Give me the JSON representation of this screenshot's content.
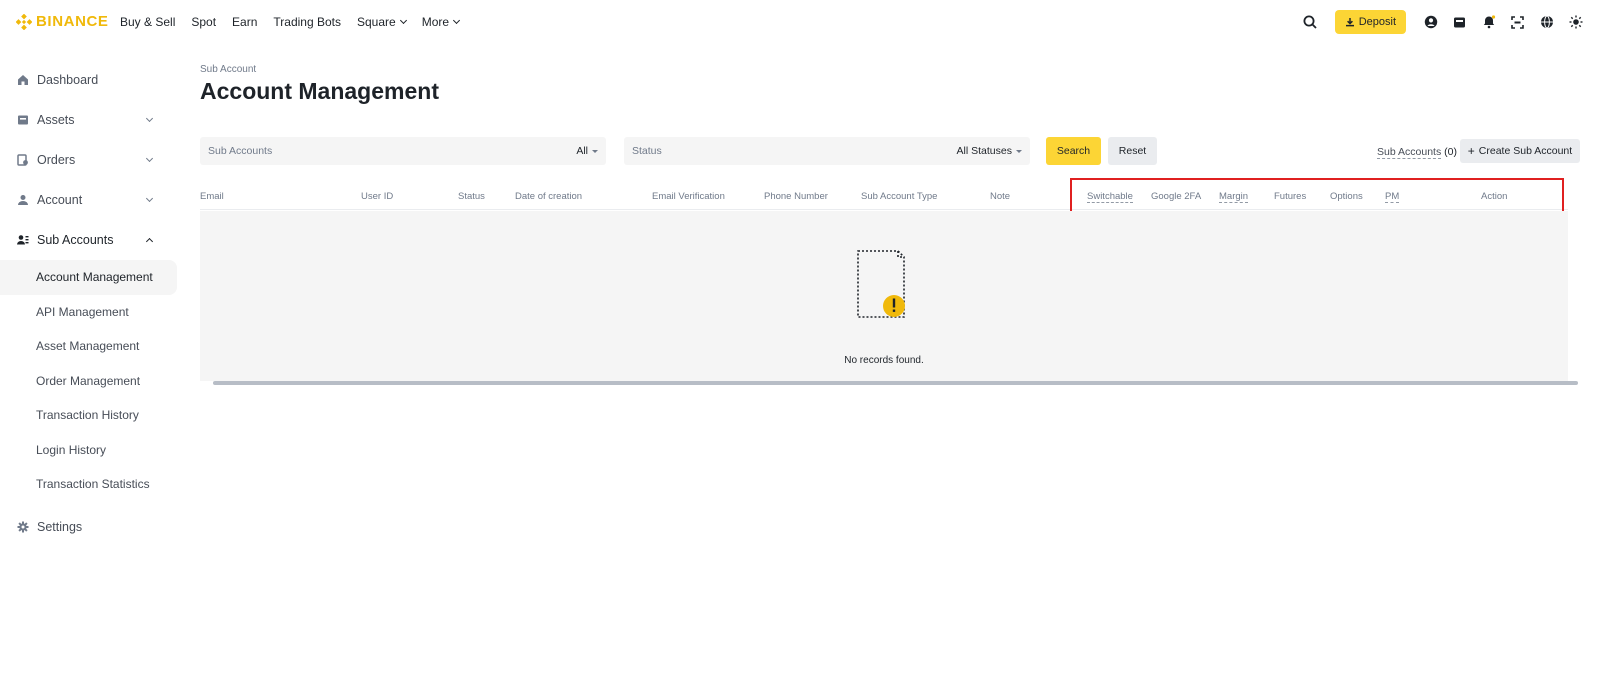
{
  "brand": {
    "name": "BINANCE",
    "color": "#f0b90b",
    "accent": "#fcd535"
  },
  "nav": [
    {
      "label": "Buy & Sell",
      "dropdown": false
    },
    {
      "label": "Spot",
      "dropdown": false
    },
    {
      "label": "Earn",
      "dropdown": false
    },
    {
      "label": "Trading Bots",
      "dropdown": false
    },
    {
      "label": "Square",
      "dropdown": true
    },
    {
      "label": "More",
      "dropdown": true
    }
  ],
  "header": {
    "deposit_label": "Deposit",
    "icons": [
      "search-icon",
      "download-icon",
      "user-icon",
      "wallet-icon",
      "bell-icon",
      "scan-icon",
      "globe-icon",
      "theme-icon"
    ]
  },
  "sidebar": {
    "items": [
      {
        "label": "Dashboard",
        "icon": "home-icon"
      },
      {
        "label": "Assets",
        "icon": "wallet-icon",
        "expandable": true
      },
      {
        "label": "Orders",
        "icon": "orders-icon",
        "expandable": true
      },
      {
        "label": "Account",
        "icon": "person-icon",
        "expandable": true
      },
      {
        "label": "Sub Accounts",
        "icon": "sub-accounts-icon",
        "expandable": true,
        "open": true
      },
      {
        "label": "Settings",
        "icon": "gear-icon"
      }
    ],
    "sub_items": [
      {
        "label": "Account Management",
        "active": true
      },
      {
        "label": "API Management"
      },
      {
        "label": "Asset Management"
      },
      {
        "label": "Order Management"
      },
      {
        "label": "Transaction History"
      },
      {
        "label": "Login History"
      },
      {
        "label": "Transaction Statistics"
      }
    ]
  },
  "main": {
    "breadcrumb": "Sub Account",
    "title": "Account Management",
    "filters": {
      "sub_accounts_placeholder": "Sub Accounts",
      "sub_accounts_value": "All",
      "status_placeholder": "Status",
      "status_value": "All Statuses"
    },
    "search_label": "Search",
    "reset_label": "Reset",
    "sub_accounts_label": "Sub Accounts",
    "sub_accounts_count": "(0)",
    "create_label": "Create Sub Account",
    "table": {
      "columns": [
        {
          "label": "Email"
        },
        {
          "label": "User ID"
        },
        {
          "label": "Status"
        },
        {
          "label": "Date of creation"
        },
        {
          "label": "Email Verification"
        },
        {
          "label": "Phone Number"
        },
        {
          "label": "Sub Account Type"
        },
        {
          "label": "Note"
        },
        {
          "label": "Switchable",
          "tooltip": true
        },
        {
          "label": "Google 2FA"
        },
        {
          "label": "Margin",
          "tooltip": true
        },
        {
          "label": "Futures"
        },
        {
          "label": "Options"
        },
        {
          "label": "PM",
          "tooltip": true
        },
        {
          "label": "Action"
        }
      ],
      "empty_text": "No records found."
    }
  }
}
